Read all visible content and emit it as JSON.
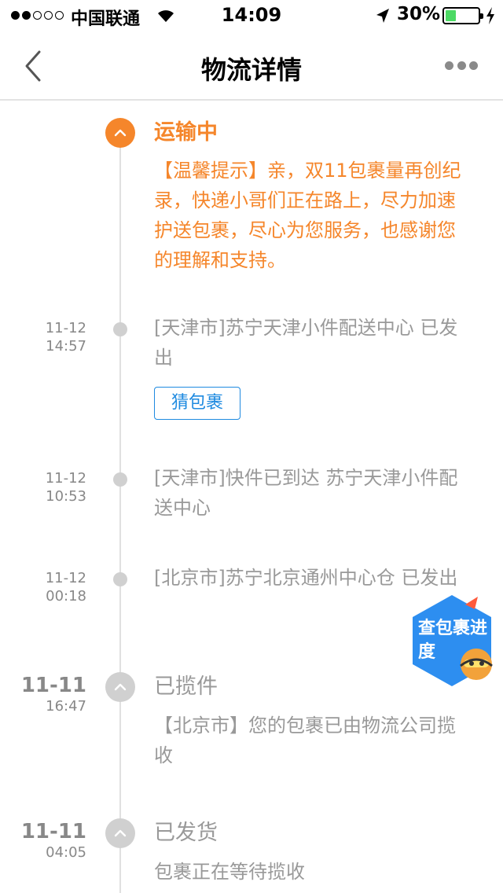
{
  "status_bar": {
    "carrier": "中国联通",
    "time": "14:09",
    "battery": "30%",
    "signal_bars_filled": 2,
    "signal_bars_total": 5,
    "battery_level": 0.3
  },
  "nav": {
    "title": "物流详情",
    "back_icon": "chevron-left-icon",
    "more_icon": "more-dots-icon"
  },
  "colors": {
    "accent": "#f5862b",
    "link": "#1e8ae0",
    "muted": "#999999"
  },
  "timeline": {
    "current": {
      "title": "运输中",
      "message": "【温馨提示】亲，双11包裹量再创纪录，快递小哥们正在路上，尽力加速护送包裹，尽心为您服务，也感谢您的理解和支持。"
    },
    "events": [
      {
        "date": "11-12",
        "time": "14:57",
        "text": "[天津市]苏宁天津小件配送中心 已发出",
        "button": "猜包裹"
      },
      {
        "date": "11-12",
        "time": "10:53",
        "text": "[天津市]快件已到达 苏宁天津小件配送中心"
      },
      {
        "date": "11-12",
        "time": "00:18",
        "text": "[北京市]苏宁北京通州中心仓 已发出"
      }
    ],
    "milestones": [
      {
        "date": "11-11",
        "time": "16:47",
        "title": "已揽件",
        "text": "【北京市】您的包裹已由物流公司揽收"
      },
      {
        "date": "11-11",
        "time": "04:05",
        "title": "已发货",
        "text": "包裹正在等待揽收"
      }
    ]
  },
  "fab": {
    "label": "查包裹进度"
  }
}
